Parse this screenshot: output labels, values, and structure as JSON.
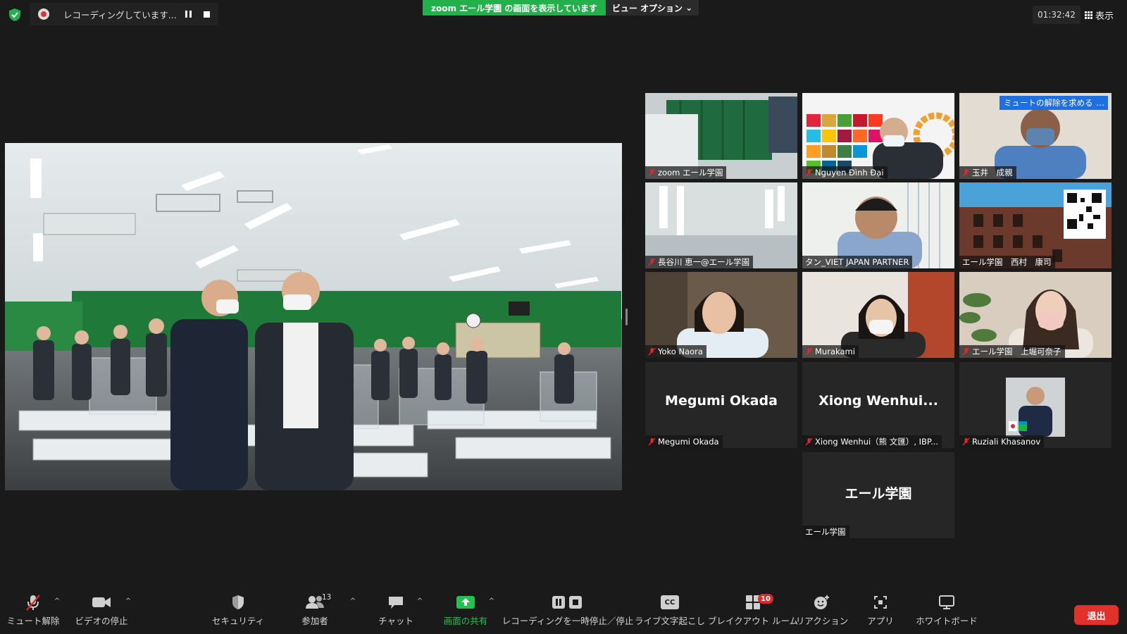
{
  "topbar": {
    "recording_text": "レコーディングしています...",
    "share_banner": "zoom エール学園 の画面を表示しています",
    "view_options": "ビュー オプション",
    "timer": "01:32:42",
    "view_button": "表示"
  },
  "gallery": {
    "tiles": [
      {
        "name": "zoom エール学園"
      },
      {
        "name": "Nguyen Đình Đại"
      },
      {
        "name": "玉井　成親",
        "request": "ミュートの解除を求める",
        "more": "…"
      },
      {
        "name": "長谷川 恵一@エール学園"
      },
      {
        "name": "タン_VIET JAPAN PARTNER"
      },
      {
        "name": "エール学園　西村　康司"
      },
      {
        "name": "Yoko Naora"
      },
      {
        "name": "Murakami"
      },
      {
        "name": "エール学園　上堀可奈子"
      },
      {
        "name": "Megumi Okada",
        "display": "Megumi Okada"
      },
      {
        "name": "Xiong Wenhui（熊 文匯）, IBP...",
        "display": "Xiong  Wenhui..."
      },
      {
        "name": "Ruziali Khasanov"
      },
      {
        "name": "エール学園",
        "display": "エール学園"
      }
    ]
  },
  "toolbar": {
    "mute": "ミュート解除",
    "video": "ビデオの停止",
    "security": "セキュリティ",
    "participants": "参加者",
    "participants_count": "13",
    "chat": "チャット",
    "share": "画面の共有",
    "recording": "レコーディングを一時停止／停止",
    "captions": "ライブ文字起こし",
    "cc": "CC",
    "breakout": "ブレイクアウト ルーム",
    "breakout_badge": "10",
    "reactions": "リアクション",
    "apps": "アプリ",
    "whiteboard": "ホワイトボード",
    "leave": "退出"
  },
  "colors": {
    "accent_green": "#23b04b",
    "danger_red": "#e0312b",
    "active_speaker": "#f2e75c",
    "request_blue": "#1f6fe0"
  }
}
